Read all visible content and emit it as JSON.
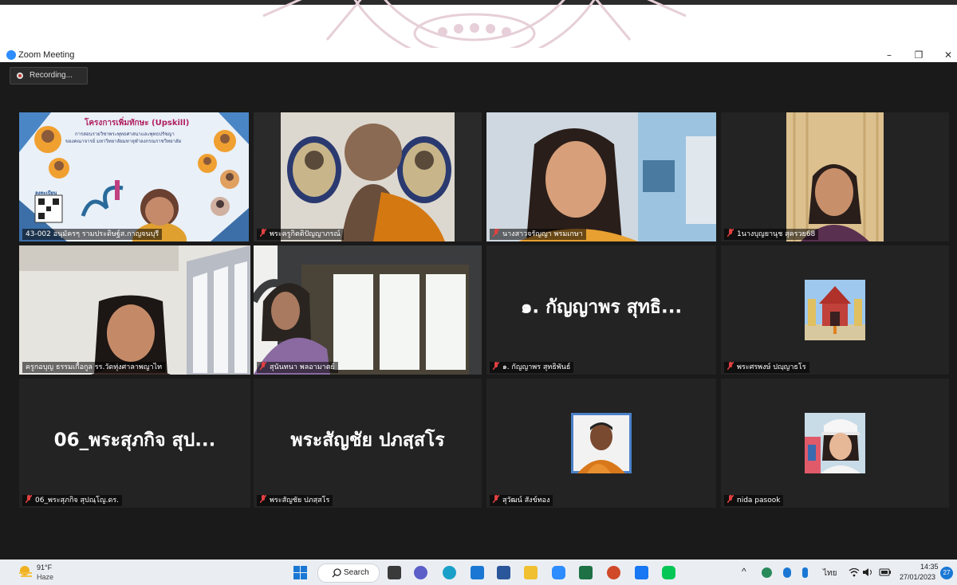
{
  "window": {
    "title": "Zoom Meeting"
  },
  "recording": {
    "label": "Recording..."
  },
  "tiles": [
    {
      "name": "43-002 อนุมัครๆ รามประดิษฐ์ส.กาญจนบุรี"
    },
    {
      "name": "พระครูกิตติปัญญาภรณ์"
    },
    {
      "name": "นางสาวจรัญญา พรมเกษา"
    },
    {
      "name": "1นางบุญยานุช สุครวย68"
    },
    {
      "name": "ครูกอบุญ ธรรมเกื้อกูล รร.วัดทุ่งศาลาพญาไท"
    },
    {
      "name": "สุนันทนา พลอามาตย์"
    },
    {
      "name": "๑. กัญญาพร สุทธิพันธ์",
      "big": "๑. กัญญาพร สุทธิ..."
    },
    {
      "name": "พระศรพงษ์ ปญฺญาธโร"
    },
    {
      "name": "06_พระสุภกิจ สุปณฺโญ.ดร.",
      "big": "06_พระสุภกิจ สุป..."
    },
    {
      "name": "พระสัญชัย ปภสฺสโร",
      "big": "พระสัญชัย ปภสฺสโร"
    },
    {
      "name": "สุวัฒน์ สังข์ทอง"
    },
    {
      "name": "nida pasook"
    }
  ],
  "slide": {
    "title": "โครงการเพิ่มทักษะ (Upskill)",
    "line1": "การสอนรายวิชาพระพุทธศาสนาและพุทธปรัชญา",
    "line2": "ของคณาจารย์ มหาวิทยาลัยมหาจุฬาลงกรณราชวิทยาลัย",
    "register": "ลงทะเบียน"
  },
  "taskbar": {
    "temp": "91°F",
    "weather": "Haze",
    "search": "Search",
    "lang": "ไทย",
    "time": "14:35",
    "date": "27/01/2023",
    "notifications": "27"
  },
  "colors": {
    "zoom_blue": "#2d8cff",
    "meeting_bg": "#1a1a1a",
    "tile_bg": "#232323",
    "active_border": "#e8ec7a",
    "taskbar_bg": "#eaeef3"
  }
}
